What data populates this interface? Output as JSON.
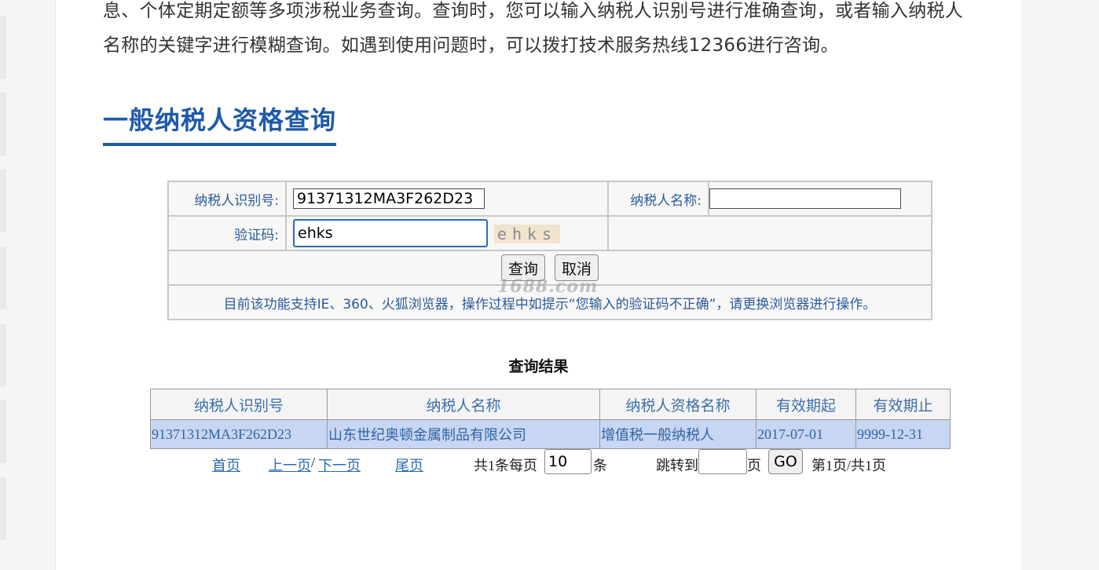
{
  "intro": {
    "line1": "息、个体定期定额等多项涉税业务查询。查询时，您可以输入纳税人识别号进行准确查询，或者输入纳税人",
    "line2": "名称的关键字进行模糊查询。如遇到使用问题时，可以拨打技术服务热线12366进行咨询。"
  },
  "section_title": "一般纳税人资格查询",
  "form": {
    "taxpayer_id_label": "纳税人识别号:",
    "taxpayer_id_value": "91371312MA3F262D23",
    "taxpayer_name_label": "纳税人名称:",
    "taxpayer_name_value": "",
    "captcha_label": "验证码:",
    "captcha_value": "ehks",
    "captcha_image_text": "ehks",
    "query_button": "查询",
    "cancel_button": "取消",
    "notice": "目前该功能支持IE、360、火狐浏览器，操作过程中如提示“您输入的验证码不正确”，请更换浏览器进行操作。"
  },
  "watermark": "1688.com",
  "results": {
    "title": "查询结果",
    "columns": [
      "纳税人识别号",
      "纳税人名称",
      "纳税人资格名称",
      "有效期起",
      "有效期止"
    ],
    "rows": [
      [
        "91371312MA3F262D23",
        "山东世纪奥顿金属制品有限公司",
        "增值税一般纳税人",
        "2017-07-01",
        "9999-12-31"
      ]
    ]
  },
  "pager": {
    "first": "首页",
    "prev": "上一页",
    "sep": "/",
    "next": "下一页",
    "last": "尾页",
    "total_text": "共1条每页",
    "per_page_value": "10",
    "per_page_unit": "条",
    "jump_label": "跳转到",
    "jump_value": "",
    "jump_unit": "页",
    "go_button": "GO",
    "page_info": "第1页/共1页"
  },
  "colors": {
    "title_blue": "#1e5aa8",
    "label_blue": "#2b5a9b",
    "row_highlight": "#c7d6f2"
  }
}
